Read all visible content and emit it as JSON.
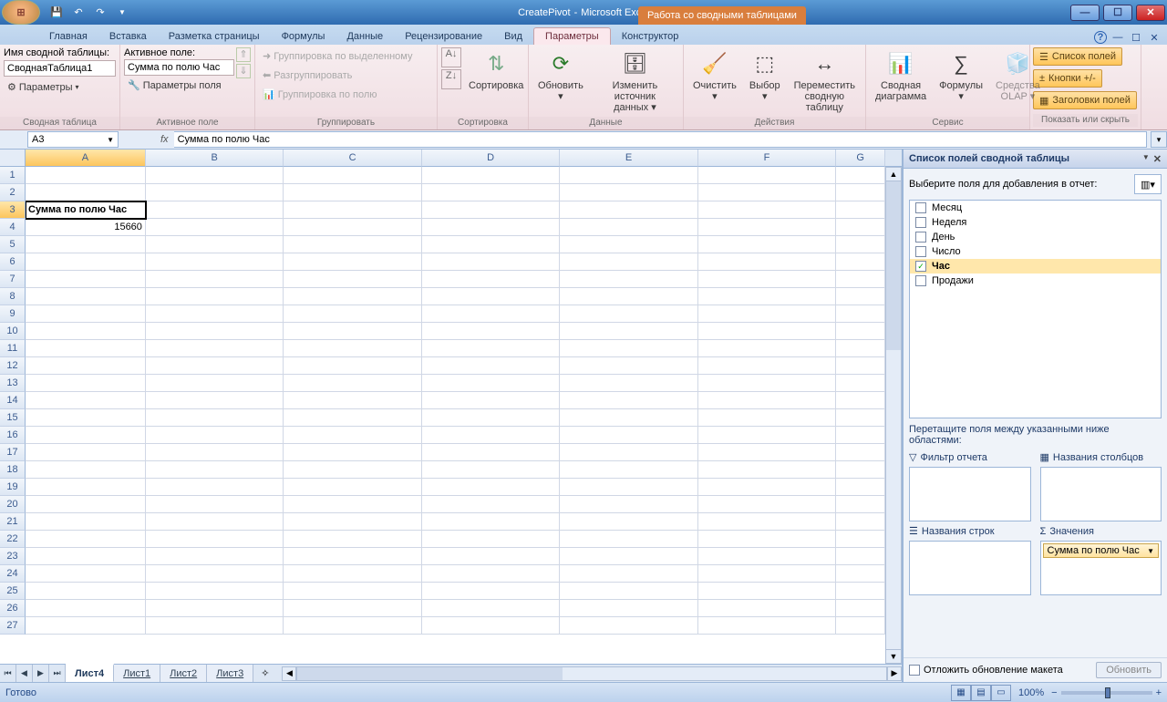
{
  "title": {
    "doc": "CreatePivot",
    "app": "Microsoft Excel",
    "context": "Работа со сводными таблицами"
  },
  "tabs": {
    "items": [
      "Главная",
      "Вставка",
      "Разметка страницы",
      "Формулы",
      "Данные",
      "Рецензирование",
      "Вид",
      "Параметры",
      "Конструктор"
    ],
    "activeIndex": 7
  },
  "ribbon": {
    "pivotTable": {
      "nameLabel": "Имя сводной таблицы:",
      "name": "СводнаяТаблица1",
      "params": "Параметры",
      "group": "Сводная таблица"
    },
    "activeField": {
      "label": "Активное поле:",
      "value": "Сумма по полю Час",
      "params": "Параметры поля",
      "group": "Активное поле"
    },
    "grouping": {
      "bysel": "Группировка по выделенному",
      "ungroup": "Разгруппировать",
      "byfield": "Группировка по полю",
      "group": "Группировать"
    },
    "sort": {
      "btn": "Сортировка",
      "group": "Сортировка"
    },
    "data": {
      "refresh": "Обновить",
      "change": "Изменить",
      "change2": "источник данных",
      "group": "Данные"
    },
    "actions": {
      "clear": "Очистить",
      "select": "Выбор",
      "move": "Переместить",
      "move2": "сводную таблицу",
      "group": "Действия"
    },
    "tools": {
      "chart": "Сводная",
      "chart2": "диаграмма",
      "formulas": "Формулы",
      "olap": "Средства",
      "olap2": "OLAP",
      "group": "Сервис"
    },
    "show": {
      "fieldlist": "Список полей",
      "buttons": "Кнопки +/-",
      "headers": "Заголовки полей",
      "group": "Показать или скрыть"
    }
  },
  "fx": {
    "cellref": "A3",
    "formula": "Сумма по полю Час"
  },
  "grid": {
    "cols": [
      "A",
      "B",
      "C",
      "D",
      "E",
      "F",
      "G"
    ],
    "rows": 27,
    "cells": {
      "A3": "Сумма по полю Час",
      "A4": "15660"
    }
  },
  "sheets": {
    "items": [
      "Лист4",
      "Лист1",
      "Лист2",
      "Лист3"
    ],
    "activeIndex": 0
  },
  "pane": {
    "title": "Список полей сводной таблицы",
    "pick": "Выберите поля для добавления в отчет:",
    "fields": [
      {
        "label": "Месяц",
        "checked": false
      },
      {
        "label": "Неделя",
        "checked": false
      },
      {
        "label": "День",
        "checked": false
      },
      {
        "label": "Число",
        "checked": false
      },
      {
        "label": "Час",
        "checked": true
      },
      {
        "label": "Продажи",
        "checked": false
      }
    ],
    "drag": "Перетащите поля между указанными ниже областями:",
    "areas": {
      "filter": "Фильтр отчета",
      "cols": "Названия столбцов",
      "rows": "Названия строк",
      "vals": "Значения"
    },
    "valueItem": "Сумма по полю Час",
    "defer": "Отложить обновление макета",
    "update": "Обновить"
  },
  "status": {
    "ready": "Готово",
    "zoom": "100%"
  }
}
